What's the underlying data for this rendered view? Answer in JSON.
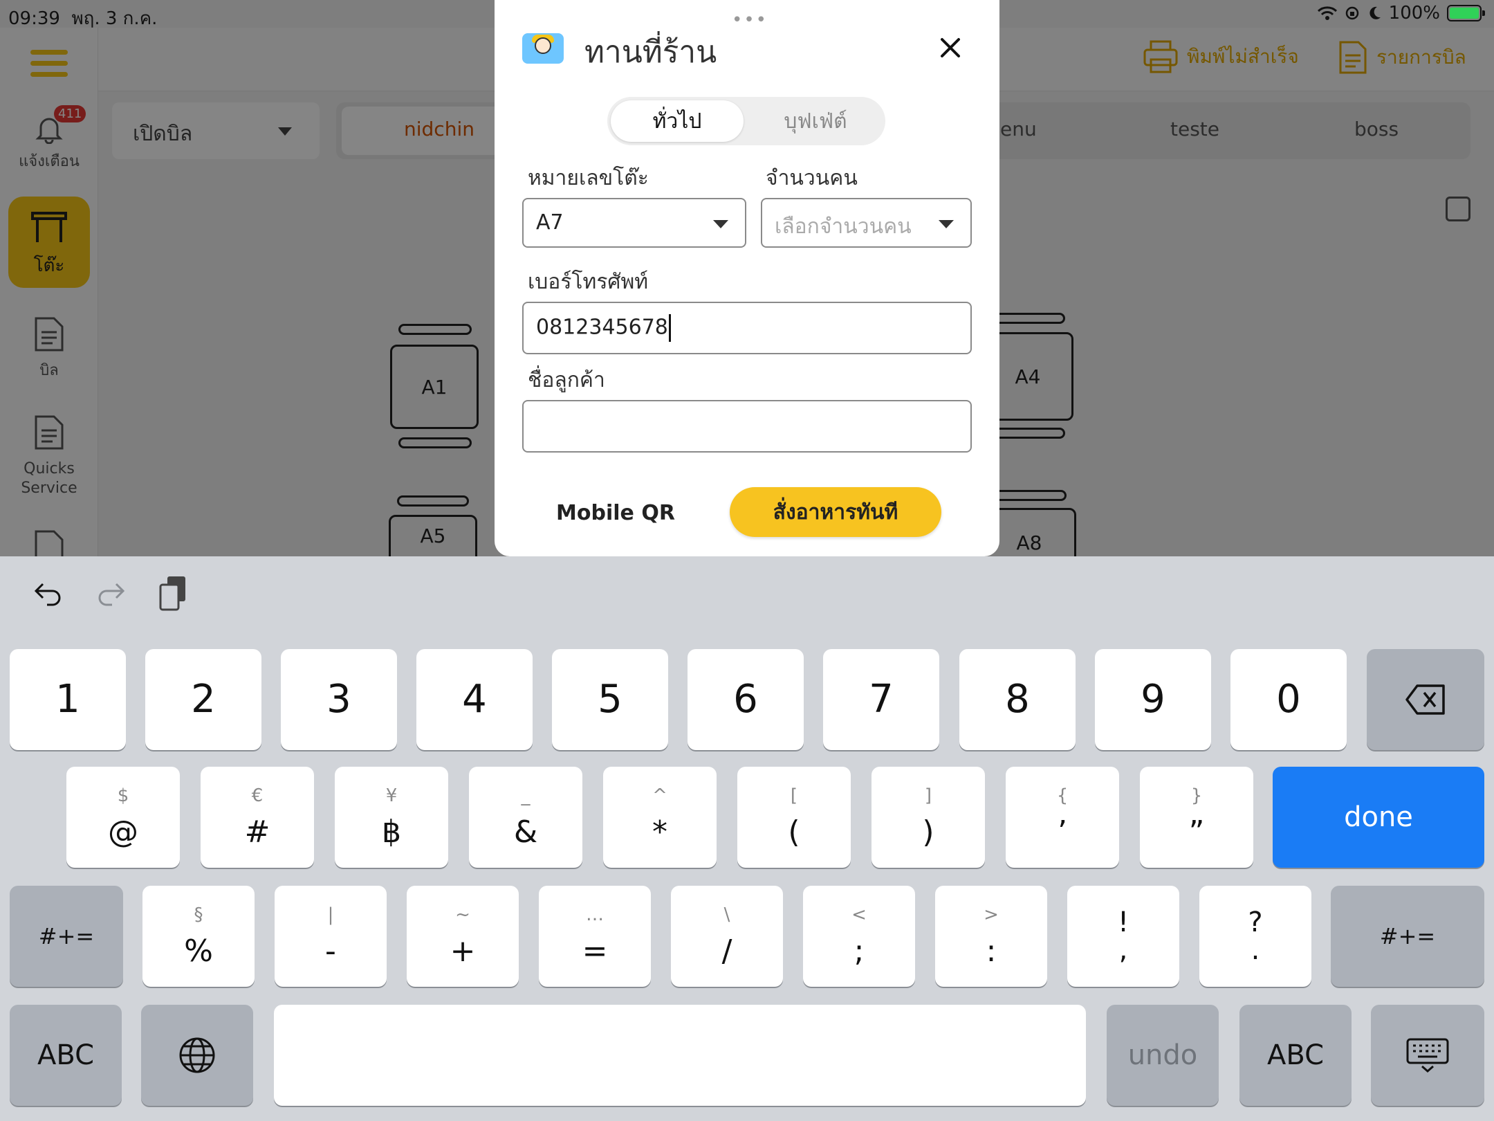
{
  "status_bar": {
    "time": "09:39",
    "date": "พฤ. 3 ก.ค.",
    "battery": "100%"
  },
  "sidebar": {
    "notification_label": "แจ้งเตือน",
    "notification_count": "411",
    "items": [
      {
        "label": "โต๊ะ",
        "active": true
      },
      {
        "label": "บิล"
      },
      {
        "label": "Quicks Service"
      }
    ]
  },
  "header": {
    "print_failed": "พิมพ์ไม่สำเร็จ",
    "bill_list": "รายการบิล"
  },
  "toolbar": {
    "open_bill": "เปิดบิล",
    "user_tabs": [
      "nidchin",
      "enu",
      "teste",
      "boss"
    ]
  },
  "tables": [
    "A1",
    "A4",
    "A5",
    "A8"
  ],
  "modal": {
    "title": "ทานที่ร้าน",
    "segments": [
      "ทั่วไป",
      "บุฟเฟ่ต์"
    ],
    "table_label": "หมายเลขโต๊ะ",
    "table_value": "A7",
    "guests_label": "จำนวนคน",
    "guests_placeholder": "เลือกจำนวนคน",
    "phone_label": "เบอร์โทรศัพท์",
    "phone_value": "0812345678",
    "name_label": "ชื่อลูกค้า",
    "name_value": "",
    "mobile_qr": "Mobile QR",
    "order_now": "สั่งอาหารทันที"
  },
  "keyboard": {
    "row1": [
      "1",
      "2",
      "3",
      "4",
      "5",
      "6",
      "7",
      "8",
      "9",
      "0"
    ],
    "row2": [
      {
        "alt": "$",
        "main": "@"
      },
      {
        "alt": "€",
        "main": "#"
      },
      {
        "alt": "¥",
        "main": "฿"
      },
      {
        "alt": "_",
        "main": "&"
      },
      {
        "alt": "^",
        "main": "*"
      },
      {
        "alt": "[",
        "main": "("
      },
      {
        "alt": "]",
        "main": ")"
      },
      {
        "alt": "{",
        "main": "’"
      },
      {
        "alt": "}",
        "main": "”"
      }
    ],
    "done": "done",
    "row3": [
      {
        "alt": "§",
        "main": "%"
      },
      {
        "alt": "|",
        "main": "-"
      },
      {
        "alt": "~",
        "main": "+"
      },
      {
        "alt": "…",
        "main": "="
      },
      {
        "alt": "\\",
        "main": "/"
      },
      {
        "alt": "<",
        "main": ";"
      },
      {
        "alt": ">",
        "main": ":"
      },
      {
        "alt": "!",
        "main": ","
      },
      {
        "alt": "?",
        "main": "."
      }
    ],
    "shift": "#+=",
    "abc": "ABC",
    "undo": "undo"
  }
}
